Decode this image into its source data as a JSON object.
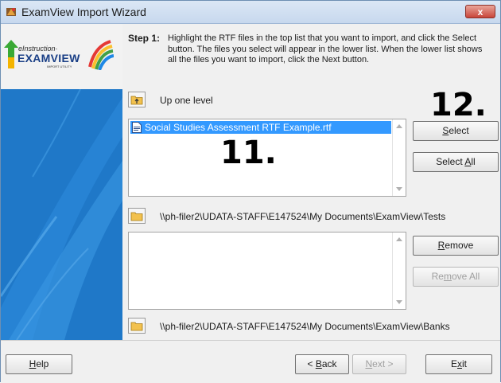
{
  "window": {
    "title": "ExamView Import Wizard",
    "close_label": "x"
  },
  "logo": {
    "small_text": "eInstruction·",
    "big_text": "EXAMVIEW",
    "sub_text": "IMPORT UTILITY"
  },
  "step": {
    "label": "Step 1:",
    "instructions": "Highlight the RTF files in the top list that you want to import, and click the Select button.  The files you select will appear in the lower list.  When the lower list shows all the files you want to import, click the Next button."
  },
  "top_list": {
    "up_label": "Up one level",
    "items": [
      {
        "label": "Social Studies Assessment RTF Example.rtf",
        "selected": true
      }
    ]
  },
  "buttons": {
    "select": {
      "pre": "",
      "key": "S",
      "post": "elect"
    },
    "select_all": {
      "pre": "Select ",
      "key": "A",
      "post": "ll"
    },
    "remove": {
      "pre": "",
      "key": "R",
      "post": "emove"
    },
    "remove_all": {
      "pre": "Re",
      "key": "m",
      "post": "ove All"
    }
  },
  "paths": {
    "tests": "\\\\ph-filer2\\UDATA-STAFF\\E147524\\My Documents\\ExamView\\Tests",
    "banks": "\\\\ph-filer2\\UDATA-STAFF\\E147524\\My Documents\\ExamView\\Banks"
  },
  "annotations": {
    "n11": "11.",
    "n12": "12."
  },
  "footer": {
    "help": {
      "pre": "",
      "key": "H",
      "post": "elp"
    },
    "back": {
      "pre": "< ",
      "key": "B",
      "post": "ack"
    },
    "next": {
      "pre": "",
      "key": "N",
      "post": "ext >"
    },
    "exit": {
      "pre": "E",
      "key": "x",
      "post": "it"
    }
  },
  "colors": {
    "selection": "#3399ff",
    "panel_blue": "#1f78c8",
    "close_red": "#c8453a"
  }
}
